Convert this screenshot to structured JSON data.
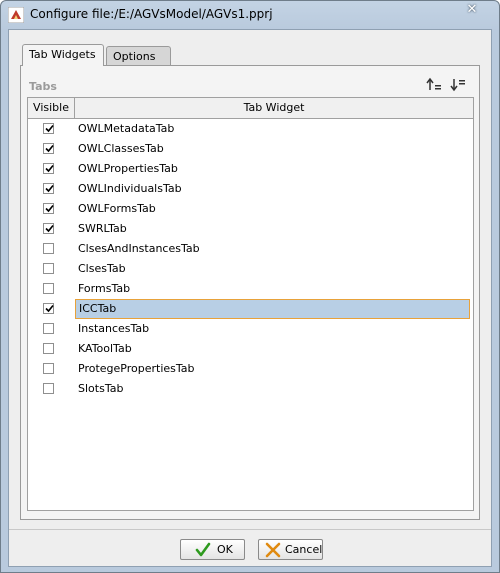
{
  "window": {
    "title": "Configure file:/E:/AGVsModel/AGVs1.pprj",
    "close_label": "✕"
  },
  "tabs": [
    {
      "label": "Tab Widgets",
      "active": true
    },
    {
      "label": "Options",
      "active": false
    }
  ],
  "panel": {
    "section_label": "Tabs",
    "columns": {
      "visible": "Visible",
      "widget": "Tab Widget"
    },
    "rows": [
      {
        "name": "OWLMetadataTab",
        "visible": true
      },
      {
        "name": "OWLClassesTab",
        "visible": true
      },
      {
        "name": "OWLPropertiesTab",
        "visible": true
      },
      {
        "name": "OWLIndividualsTab",
        "visible": true
      },
      {
        "name": "OWLFormsTab",
        "visible": true
      },
      {
        "name": "SWRLTab",
        "visible": true
      },
      {
        "name": "ClsesAndInstancesTab",
        "visible": false
      },
      {
        "name": "ClsesTab",
        "visible": false
      },
      {
        "name": "FormsTab",
        "visible": false
      },
      {
        "name": "ICCTab",
        "visible": true,
        "selected": true
      },
      {
        "name": "InstancesTab",
        "visible": false
      },
      {
        "name": "KAToolTab",
        "visible": false
      },
      {
        "name": "ProtegePropertiesTab",
        "visible": false
      },
      {
        "name": "SlotsTab",
        "visible": false
      }
    ]
  },
  "buttons": {
    "ok": "OK",
    "cancel": "Cancel"
  },
  "colors": {
    "title_bar": "#b9cadd",
    "selection": "#b8cfe5",
    "selection_border": "#e8a23a",
    "ok_check": "#2e9a1e",
    "cancel_x": "#e08a10"
  }
}
